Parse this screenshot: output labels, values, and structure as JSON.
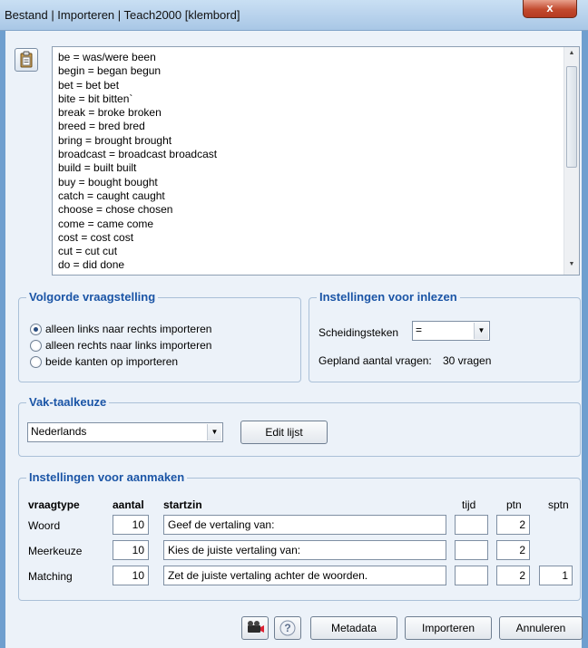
{
  "window": {
    "title": "Bestand | Importeren | Teach2000 [klembord]",
    "close_label": "x"
  },
  "clipboard_text": [
    "be = was/were been",
    "begin = began begun",
    "bet = bet bet",
    "bite = bit bitten`",
    "break = broke broken",
    "breed = bred bred",
    "bring = brought brought",
    "broadcast = broadcast broadcast",
    "build = built built",
    "buy = bought bought",
    "catch = caught caught",
    "choose = chose chosen",
    "come = came come",
    "cost = cost cost",
    "cut = cut cut",
    "do = did done"
  ],
  "volgorde": {
    "title": "Volgorde vraagstelling",
    "options": [
      "alleen links naar rechts importeren",
      "alleen rechts naar links importeren",
      "beide kanten op importeren"
    ],
    "selected_index": 0
  },
  "inlezen": {
    "title": "Instellingen voor inlezen",
    "separator_label": "Scheidingsteken",
    "separator_value": "=",
    "planned_label": "Gepland aantal vragen:",
    "planned_value": "30 vragen"
  },
  "vak": {
    "title": "Vak-taalkeuze",
    "selected": "Nederlands",
    "edit_button": "Edit lijst"
  },
  "aanmaken": {
    "title": "Instellingen voor aanmaken",
    "headers": {
      "type": "vraagtype",
      "count": "aantal",
      "start": "startzin",
      "time": "tijd",
      "points": "ptn",
      "spoints": "sptn"
    },
    "rows": [
      {
        "type": "Woord",
        "count": "10",
        "start": "Geef de vertaling van:",
        "time": "",
        "points": "2",
        "spoints": null
      },
      {
        "type": "Meerkeuze",
        "count": "10",
        "start": "Kies de juiste vertaling van:",
        "time": "",
        "points": "2",
        "spoints": null
      },
      {
        "type": "Matching",
        "count": "10",
        "start": "Zet de juiste vertaling achter de woorden.",
        "time": "",
        "points": "2",
        "spoints": "1"
      }
    ]
  },
  "footer": {
    "metadata": "Metadata",
    "import": "Importeren",
    "cancel": "Annuleren"
  },
  "colors": {
    "group_title": "#1b55a6",
    "client_bg": "#ecf2f9",
    "frame": "#6f9fcf"
  }
}
